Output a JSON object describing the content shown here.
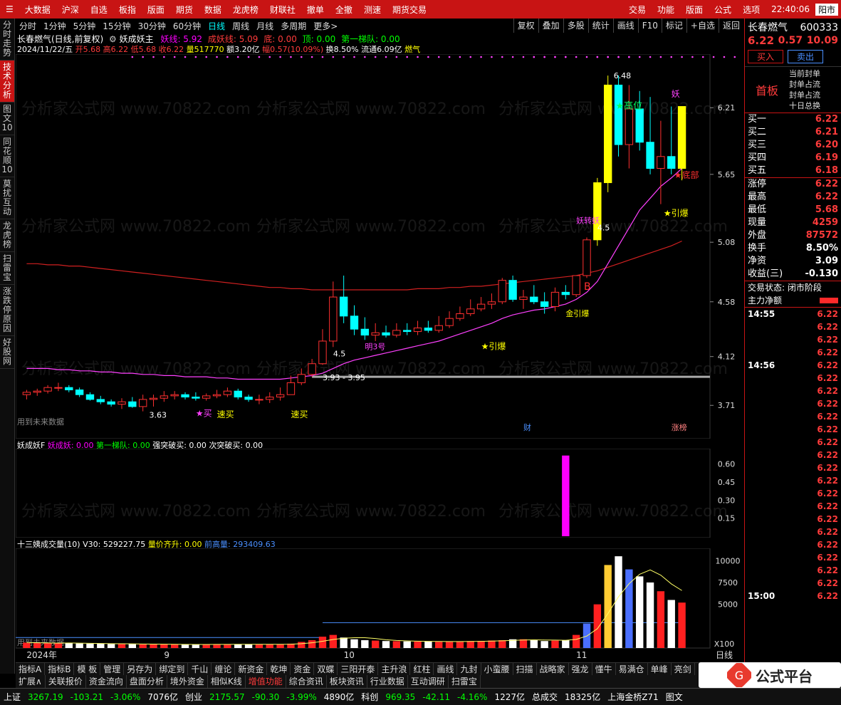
{
  "menubar": {
    "left": [
      "大数据",
      "沪深",
      "自选",
      "板指",
      "版面",
      "期货",
      "数据",
      "龙虎榜",
      "财联社",
      "撤单",
      "全撤",
      "测速",
      "期货交易"
    ],
    "right": [
      "交易",
      "功能",
      "版面",
      "公式",
      "选项"
    ],
    "clock": "22:40:06",
    "window_btn": "阳市"
  },
  "leftnav": [
    "分时走势",
    "技术分析",
    "图文10",
    "同花顺10",
    "莫扰互动",
    "龙虎榜",
    "扫雷宝",
    "涨跌停原因",
    "好股网"
  ],
  "periods": [
    "分时",
    "1分钟",
    "5分钟",
    "15分钟",
    "30分钟",
    "60分钟",
    "日线",
    "周线",
    "月线",
    "多周期",
    "更多>"
  ],
  "active_period": "日线",
  "toolbar": [
    "复权",
    "叠加",
    "多股",
    "统计",
    "画线",
    "F10",
    "标记",
    "+自选",
    "返回"
  ],
  "title": {
    "name": "长春燃气(日线,前复权)",
    "indicator": "妖成妖主",
    "yaoxian": "妖线: 5.92",
    "chengyao": "成妖线: 5.09",
    "di": "底: 0.00",
    "ding": "顶: 0.00",
    "diyi": "第一梯队: 0.00"
  },
  "ohlc": {
    "date": "2024/11/22/五",
    "open": "开5.68",
    "high": "高6.22",
    "low": "低5.68",
    "close": "收6.22",
    "vol": "量517770",
    "amount": "额3.20亿",
    "amp": "幅0.57(10.09%)",
    "turnover": "换8.50%",
    "float": "流通6.09亿",
    "sector": "燃气"
  },
  "price_axis": [
    "6.21",
    "5.65",
    "5.08",
    "4.58",
    "4.12",
    "3.71"
  ],
  "annotations": {
    "high_label": "6.48",
    "gaowei": "★高位",
    "dibu": "★底部",
    "yinbao1": "★引爆",
    "yinbao2": "★引爆",
    "yao": "妖",
    "B": "B",
    "range_label": "3.93 - 3.95",
    "low_label": "3.63",
    "mark45a": "4.5",
    "mark45b": "4.5",
    "mai": "★买",
    "sumai1": "速买",
    "sumai2": "速买",
    "future_data": "用到未来数据",
    "cai": "财",
    "zhangbang": "涨榜",
    "yinbao3": "金引爆",
    "ming3hao": "明3号",
    "yaoyao": "妖转妖"
  },
  "pane2": {
    "label": "妖成妖F",
    "v1": "妖成妖: 0.00",
    "v2": "第一梯队: 0.00",
    "v3": "强突破买: 0.00",
    "v4": "次突破买: 0.00",
    "axis": [
      "0.60",
      "0.45",
      "0.30",
      "0.15"
    ]
  },
  "pane3": {
    "label": "十三姨成交量(10)",
    "v30": "V30: 529227.75",
    "liang": "量价齐升: 0.00",
    "qiangao": "前高量: 293409.63",
    "axis": [
      "10000",
      "7500",
      "5000"
    ],
    "unit": "X100",
    "future": "用到未来数据"
  },
  "xaxis": [
    "2024年",
    "9",
    "10",
    "11"
  ],
  "xaxis_right": "日线",
  "rightpanel": {
    "name": "长春燃气",
    "code": "600333",
    "price": "6.22",
    "change": "0.57",
    "pct": "10.09",
    "buy_btn": "买入",
    "sell_btn": "卖出",
    "board": "首板",
    "board_info": [
      "当前封单",
      "封单占流",
      "封单占流",
      "十日总换"
    ],
    "bids": [
      {
        "label": "买一",
        "price": "6.22"
      },
      {
        "label": "买二",
        "price": "6.21"
      },
      {
        "label": "买三",
        "price": "6.20"
      },
      {
        "label": "买四",
        "price": "6.19"
      },
      {
        "label": "买五",
        "price": "6.18"
      }
    ],
    "stats": [
      {
        "label": "涨停",
        "value": "6.22"
      },
      {
        "label": "最高",
        "value": "6.22"
      },
      {
        "label": "最低",
        "value": "5.68"
      },
      {
        "label": "现量",
        "value": "4259"
      },
      {
        "label": "外盘",
        "value": "87572"
      },
      {
        "label": "换手",
        "value": "8.50%"
      },
      {
        "label": "净资",
        "value": "3.09"
      },
      {
        "label": "收益(三)",
        "value": "-0.130"
      }
    ],
    "trade_status": "交易状态: 闭市阶段",
    "main_money": "主力净额",
    "ticks": [
      {
        "time": "14:55",
        "price": "6.22"
      },
      {
        "time": "",
        "price": "6.22"
      },
      {
        "time": "",
        "price": "6.22"
      },
      {
        "time": "",
        "price": "6.22"
      },
      {
        "time": "14:56",
        "price": "6.22"
      },
      {
        "time": "",
        "price": "6.22"
      },
      {
        "time": "",
        "price": "6.22"
      },
      {
        "time": "",
        "price": "6.22"
      },
      {
        "time": "",
        "price": "6.22"
      },
      {
        "time": "",
        "price": "6.22"
      },
      {
        "time": "",
        "price": "6.22"
      },
      {
        "time": "",
        "price": "6.22"
      },
      {
        "time": "",
        "price": "6.22"
      },
      {
        "time": "",
        "price": "6.22"
      },
      {
        "time": "",
        "price": "6.22"
      },
      {
        "time": "",
        "price": "6.22"
      },
      {
        "time": "",
        "price": "6.22"
      },
      {
        "time": "",
        "price": "6.22"
      },
      {
        "time": "",
        "price": "6.22"
      },
      {
        "time": "",
        "price": "6.22"
      },
      {
        "time": "",
        "price": "6.22"
      },
      {
        "time": "",
        "price": "6.22"
      },
      {
        "time": "15:00",
        "price": "6.22"
      }
    ]
  },
  "bottomtabs": [
    "指标A",
    "指标B",
    "模 板",
    "管理",
    "另存为",
    "绑定到",
    "千山",
    "缠论",
    "新资金",
    "乾坤",
    "资金",
    "双蝶",
    "三阳开泰",
    "主升浪",
    "红柱",
    "画线",
    "九封",
    "小蛮腰",
    "扫描",
    "战略家",
    "强龙",
    "懂牛",
    "易满仓",
    "单峰",
    "亮剑"
  ],
  "bottomtabs2": [
    "扩展∧",
    "关联报价",
    "资金流向",
    "盘面分析",
    "境外资金",
    "相似K线",
    "增值功能",
    "综合资讯",
    "板块资讯",
    "行业数据",
    "互动调研",
    "扫雷宝"
  ],
  "statusbar": [
    {
      "name": "上证",
      "val": "3267.19",
      "chg": "-103.21",
      "pct": "-3.06%",
      "amt": "7076亿"
    },
    {
      "name": "创业",
      "val": "2175.57",
      "chg": "-90.30",
      "pct": "-3.99%",
      "amt": "4890亿"
    },
    {
      "name": "科创",
      "val": "969.35",
      "chg": "-42.11",
      "pct": "-4.16%",
      "amt": "1227亿"
    }
  ],
  "status_total_label": "总成交",
  "status_total": "18325亿",
  "status_server": "上海金桥Z71",
  "status_tw": "图文",
  "logo_text": "公式平台",
  "logo_url": "www.gspt.com",
  "watermark": "分析家公式网 www.70822.com",
  "chart_data": {
    "type": "candlestick",
    "title": "长春燃气(日线,前复权)",
    "ylim": [
      3.55,
      6.6
    ],
    "x": [
      "2024-08-19",
      "2024-08-20",
      "2024-08-21",
      "2024-08-22",
      "2024-08-23",
      "2024-08-26",
      "2024-08-27",
      "2024-08-28",
      "2024-08-29",
      "2024-08-30",
      "2024-09-02",
      "2024-09-03",
      "2024-09-04",
      "2024-09-05",
      "2024-09-06",
      "2024-09-09",
      "2024-09-10",
      "2024-09-11",
      "2024-09-12",
      "2024-09-13",
      "2024-09-18",
      "2024-09-19",
      "2024-09-20",
      "2024-09-23",
      "2024-09-24",
      "2024-09-25",
      "2024-09-26",
      "2024-09-27",
      "2024-09-30",
      "2024-10-08",
      "2024-10-09",
      "2024-10-10",
      "2024-10-11",
      "2024-10-14",
      "2024-10-15",
      "2024-10-16",
      "2024-10-17",
      "2024-10-18",
      "2024-10-21",
      "2024-10-22",
      "2024-10-23",
      "2024-10-24",
      "2024-10-25",
      "2024-10-28",
      "2024-10-29",
      "2024-10-30",
      "2024-10-31",
      "2024-11-01",
      "2024-11-04",
      "2024-11-05",
      "2024-11-06",
      "2024-11-07",
      "2024-11-08",
      "2024-11-11",
      "2024-11-12",
      "2024-11-13",
      "2024-11-14",
      "2024-11-15",
      "2024-11-18",
      "2024-11-19",
      "2024-11-20",
      "2024-11-21",
      "2024-11-22"
    ],
    "open": [
      3.8,
      3.82,
      3.83,
      3.86,
      3.86,
      3.84,
      3.8,
      3.76,
      3.74,
      3.72,
      3.74,
      3.7,
      3.76,
      3.77,
      3.79,
      3.8,
      3.78,
      3.77,
      3.79,
      3.8,
      3.83,
      3.78,
      3.76,
      3.76,
      3.78,
      3.8,
      3.9,
      3.97,
      4.06,
      4.25,
      4.62,
      4.46,
      4.35,
      4.3,
      4.32,
      4.3,
      4.34,
      4.33,
      4.36,
      4.34,
      4.38,
      4.44,
      4.48,
      4.52,
      4.56,
      4.58,
      4.76,
      4.6,
      4.62,
      4.58,
      4.54,
      4.66,
      4.64,
      4.8,
      5.1,
      5.58,
      6.4,
      5.9,
      6.2,
      5.92,
      5.7,
      5.8,
      5.7
    ],
    "high": [
      3.84,
      3.85,
      3.88,
      3.9,
      3.88,
      3.86,
      3.82,
      3.79,
      3.76,
      3.77,
      3.78,
      3.8,
      3.8,
      3.83,
      3.83,
      3.82,
      3.82,
      3.81,
      3.84,
      3.86,
      3.85,
      3.8,
      3.8,
      3.82,
      3.86,
      3.96,
      4.02,
      4.1,
      4.35,
      4.75,
      4.8,
      4.55,
      4.45,
      4.4,
      4.38,
      4.4,
      4.4,
      4.42,
      4.42,
      4.46,
      4.5,
      4.54,
      4.6,
      4.62,
      4.65,
      4.78,
      4.8,
      4.68,
      4.72,
      4.66,
      4.7,
      4.72,
      4.8,
      5.12,
      5.62,
      6.48,
      6.48,
      6.4,
      6.35,
      6.3,
      6.1,
      6.22,
      6.22
    ],
    "low": [
      3.76,
      3.79,
      3.81,
      3.83,
      3.82,
      3.78,
      3.75,
      3.72,
      3.7,
      3.68,
      3.69,
      3.66,
      3.7,
      3.74,
      3.76,
      3.76,
      3.75,
      3.75,
      3.77,
      3.78,
      3.76,
      3.74,
      3.72,
      3.73,
      3.75,
      3.8,
      3.88,
      3.95,
      4.05,
      4.2,
      4.4,
      4.3,
      4.26,
      4.25,
      4.28,
      4.28,
      4.3,
      4.3,
      4.32,
      4.32,
      4.36,
      4.42,
      4.46,
      4.5,
      4.52,
      4.56,
      4.58,
      4.52,
      4.56,
      4.48,
      4.5,
      4.6,
      4.62,
      4.78,
      5.05,
      5.5,
      5.8,
      5.7,
      5.85,
      5.65,
      5.4,
      5.65,
      5.6
    ],
    "close": [
      3.82,
      3.83,
      3.86,
      3.86,
      3.84,
      3.8,
      3.76,
      3.74,
      3.72,
      3.74,
      3.7,
      3.76,
      3.77,
      3.79,
      3.8,
      3.78,
      3.77,
      3.79,
      3.8,
      3.83,
      3.78,
      3.76,
      3.76,
      3.78,
      3.8,
      3.9,
      3.97,
      4.06,
      4.25,
      4.62,
      4.46,
      4.35,
      4.3,
      4.32,
      4.3,
      4.34,
      4.33,
      4.36,
      4.34,
      4.38,
      4.44,
      4.48,
      4.52,
      4.56,
      4.58,
      4.76,
      4.6,
      4.62,
      4.58,
      4.54,
      4.66,
      4.64,
      4.8,
      5.1,
      5.58,
      6.4,
      5.9,
      6.2,
      5.92,
      5.7,
      5.8,
      5.7,
      6.22
    ],
    "volume": [
      620,
      600,
      580,
      560,
      540,
      520,
      500,
      490,
      470,
      460,
      450,
      430,
      420,
      420,
      410,
      400,
      410,
      420,
      430,
      440,
      430,
      420,
      410,
      430,
      450,
      500,
      700,
      900,
      1300,
      1500,
      1200,
      1000,
      900,
      850,
      800,
      780,
      760,
      750,
      740,
      720,
      730,
      760,
      800,
      820,
      860,
      900,
      1000,
      1000,
      900,
      800,
      850,
      900,
      1500,
      2800,
      5000,
      9500,
      10500,
      9000,
      8200,
      7500,
      6500,
      5500,
      5200
    ],
    "ma_purple": [
      4.02,
      4.02,
      4.02,
      4.01,
      4.01,
      4.0,
      4.0,
      3.99,
      3.99,
      3.98,
      3.98,
      3.97,
      3.97,
      3.96,
      3.96,
      3.95,
      3.95,
      3.95,
      3.94,
      3.94,
      3.93,
      3.93,
      3.93,
      3.93,
      3.93,
      3.94,
      3.95,
      3.96,
      3.98,
      4.02,
      4.06,
      4.09,
      4.11,
      4.13,
      4.15,
      4.17,
      4.19,
      4.21,
      4.23,
      4.25,
      4.28,
      4.31,
      4.34,
      4.37,
      4.4,
      4.44,
      4.47,
      4.49,
      4.51,
      4.52,
      4.54,
      4.56,
      4.6,
      4.66,
      4.75,
      4.9,
      5.05,
      5.2,
      5.35,
      5.45,
      5.55,
      5.62,
      5.7
    ],
    "ma_red": [
      4.9,
      4.9,
      4.89,
      4.89,
      4.88,
      4.88,
      4.87,
      4.86,
      4.85,
      4.84,
      4.83,
      4.82,
      4.81,
      4.8,
      4.79,
      4.78,
      4.77,
      4.76,
      4.75,
      4.74,
      4.73,
      4.72,
      4.71,
      4.7,
      4.7,
      4.69,
      4.69,
      4.68,
      4.68,
      4.68,
      4.68,
      4.68,
      4.68,
      4.68,
      4.68,
      4.68,
      4.68,
      4.69,
      4.69,
      4.69,
      4.7,
      4.7,
      4.71,
      4.71,
      4.72,
      4.73,
      4.74,
      4.75,
      4.76,
      4.77,
      4.78,
      4.79,
      4.8,
      4.82,
      4.84,
      4.87,
      4.9,
      4.93,
      4.96,
      4.99,
      5.02,
      5.05,
      5.09
    ],
    "pane2_spike": {
      "x": "2024-11-07",
      "value": 0.67
    },
    "pane2_ylim": [
      0,
      0.68
    ],
    "vol_ylim": [
      0,
      11000
    ]
  }
}
